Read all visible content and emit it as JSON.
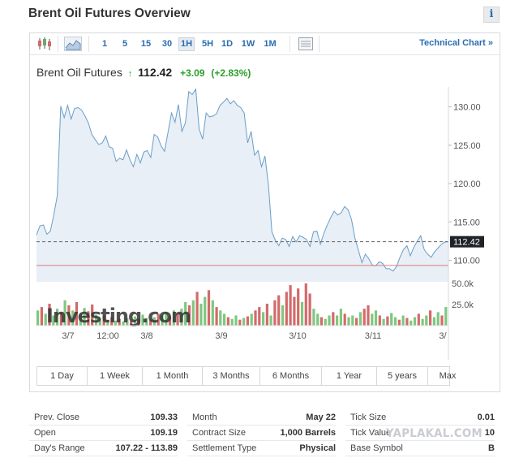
{
  "page": {
    "title": "Brent Oil Futures Overview",
    "info_icon": "i"
  },
  "toolbar": {
    "timeframes": [
      "1",
      "5",
      "15",
      "30",
      "1H",
      "5H",
      "1D",
      "1W",
      "1M"
    ],
    "active_timeframe": "1H",
    "technical_chart_label": "Technical Chart »"
  },
  "quote": {
    "name": "Brent Oil Futures",
    "arrow": "↑",
    "price": "112.42",
    "change": "+3.09",
    "change_pct": "(+2.83%)",
    "up_color": "#2ba02b"
  },
  "chart_data": {
    "type": "area",
    "title": "",
    "xlabel": "",
    "ylabel": "",
    "x_tick_labels": [
      "3/7",
      "12:00",
      "3/8",
      "3/9",
      "3/10",
      "3/11",
      "3/"
    ],
    "y_tick_labels": [
      "130.00",
      "125.00",
      "120.00",
      "115.00",
      "110.00"
    ],
    "ylim": [
      107.2,
      132.6
    ],
    "last_price": 112.42,
    "last_price_label": "112.42",
    "prev_close": 109.33,
    "grid": false,
    "series": [
      {
        "values": [
          113.3,
          114.5,
          114.6,
          113.4,
          113.8,
          115.9,
          118.4,
          130.1,
          128.6,
          130.2,
          128.4,
          129.8,
          129.9,
          129.6,
          128.8,
          127.9,
          126.4,
          125.7,
          125.1,
          125.3,
          126.2,
          124.8,
          124.6,
          122.9,
          123.3,
          123.1,
          124.4,
          123.1,
          122.2,
          123.8,
          122.7,
          124.1,
          124.3,
          123.4,
          126.4,
          126.1,
          124.9,
          124.2,
          126.7,
          129.2,
          128.0,
          130.3,
          126.8,
          127.9,
          132.0,
          131.6,
          132.3,
          127.1,
          125.8,
          129.2,
          128.7,
          128.8,
          129.1,
          130.2,
          130.6,
          131.1,
          130.4,
          130.8,
          130.2,
          129.9,
          129.2,
          125.3,
          126.8,
          123.7,
          124.3,
          122.2,
          123.6,
          119.8,
          113.7,
          112.6,
          111.9,
          112.9,
          112.7,
          111.8,
          113.1,
          112.4,
          113.2,
          113.0,
          112.7,
          111.8,
          113.7,
          113.8,
          112.1,
          113.5,
          114.6,
          115.6,
          116.4,
          115.9,
          116.2,
          117.0,
          116.6,
          115.3,
          112.9,
          111.3,
          109.7,
          110.8,
          110.2,
          109.4,
          109.3,
          109.8,
          109.6,
          108.9,
          108.9,
          108.6,
          109.2,
          110.4,
          111.4,
          111.9,
          110.6,
          111.7,
          112.5,
          113.2,
          111.4,
          110.8,
          110.4,
          111.1,
          111.6,
          112.1,
          112.4,
          112.42
        ],
        "color": "#6a9ec8",
        "fill": "#e8eff6"
      }
    ],
    "volume": {
      "tick_labels": [
        "50.0k",
        "25.0k"
      ],
      "bars": [
        {
          "v": 18,
          "c": "g"
        },
        {
          "v": 22,
          "c": "r"
        },
        {
          "v": 14,
          "c": "g"
        },
        {
          "v": 26,
          "c": "r"
        },
        {
          "v": 12,
          "c": "g"
        },
        {
          "v": 20,
          "c": "g"
        },
        {
          "v": 16,
          "c": "r"
        },
        {
          "v": 30,
          "c": "g"
        },
        {
          "v": 24,
          "c": "r"
        },
        {
          "v": 18,
          "c": "g"
        },
        {
          "v": 28,
          "c": "r"
        },
        {
          "v": 14,
          "c": "g"
        },
        {
          "v": 21,
          "c": "g"
        },
        {
          "v": 17,
          "c": "r"
        },
        {
          "v": 25,
          "c": "r"
        },
        {
          "v": 13,
          "c": "g"
        },
        {
          "v": 9,
          "c": "g"
        },
        {
          "v": 12,
          "c": "r"
        },
        {
          "v": 7,
          "c": "g"
        },
        {
          "v": 10,
          "c": "r"
        },
        {
          "v": 6,
          "c": "g"
        },
        {
          "v": 8,
          "c": "r"
        },
        {
          "v": 5,
          "c": "g"
        },
        {
          "v": 9,
          "c": "g"
        },
        {
          "v": 6,
          "c": "r"
        },
        {
          "v": 11,
          "c": "g"
        },
        {
          "v": 8,
          "c": "r"
        },
        {
          "v": 13,
          "c": "g"
        },
        {
          "v": 9,
          "c": "g"
        },
        {
          "v": 7,
          "c": "r"
        },
        {
          "v": 10,
          "c": "g"
        },
        {
          "v": 14,
          "c": "r"
        },
        {
          "v": 12,
          "c": "g"
        },
        {
          "v": 16,
          "c": "g"
        },
        {
          "v": 11,
          "c": "r"
        },
        {
          "v": 18,
          "c": "g"
        },
        {
          "v": 15,
          "c": "r"
        },
        {
          "v": 20,
          "c": "g"
        },
        {
          "v": 28,
          "c": "g"
        },
        {
          "v": 24,
          "c": "r"
        },
        {
          "v": 30,
          "c": "g"
        },
        {
          "v": 40,
          "c": "r"
        },
        {
          "v": 26,
          "c": "g"
        },
        {
          "v": 34,
          "c": "g"
        },
        {
          "v": 42,
          "c": "r"
        },
        {
          "v": 30,
          "c": "g"
        },
        {
          "v": 22,
          "c": "r"
        },
        {
          "v": 18,
          "c": "g"
        },
        {
          "v": 14,
          "c": "g"
        },
        {
          "v": 10,
          "c": "r"
        },
        {
          "v": 8,
          "c": "g"
        },
        {
          "v": 12,
          "c": "g"
        },
        {
          "v": 7,
          "c": "r"
        },
        {
          "v": 9,
          "c": "g"
        },
        {
          "v": 11,
          "c": "r"
        },
        {
          "v": 14,
          "c": "g"
        },
        {
          "v": 18,
          "c": "r"
        },
        {
          "v": 22,
          "c": "r"
        },
        {
          "v": 16,
          "c": "g"
        },
        {
          "v": 26,
          "c": "r"
        },
        {
          "v": 12,
          "c": "g"
        },
        {
          "v": 30,
          "c": "r"
        },
        {
          "v": 36,
          "c": "r"
        },
        {
          "v": 24,
          "c": "g"
        },
        {
          "v": 40,
          "c": "r"
        },
        {
          "v": 48,
          "c": "r"
        },
        {
          "v": 34,
          "c": "r"
        },
        {
          "v": 44,
          "c": "r"
        },
        {
          "v": 28,
          "c": "g"
        },
        {
          "v": 50,
          "c": "r"
        },
        {
          "v": 38,
          "c": "r"
        },
        {
          "v": 20,
          "c": "g"
        },
        {
          "v": 14,
          "c": "g"
        },
        {
          "v": 10,
          "c": "r"
        },
        {
          "v": 8,
          "c": "g"
        },
        {
          "v": 12,
          "c": "g"
        },
        {
          "v": 16,
          "c": "r"
        },
        {
          "v": 12,
          "c": "g"
        },
        {
          "v": 20,
          "c": "g"
        },
        {
          "v": 14,
          "c": "r"
        },
        {
          "v": 10,
          "c": "g"
        },
        {
          "v": 12,
          "c": "g"
        },
        {
          "v": 9,
          "c": "r"
        },
        {
          "v": 16,
          "c": "g"
        },
        {
          "v": 20,
          "c": "r"
        },
        {
          "v": 24,
          "c": "r"
        },
        {
          "v": 14,
          "c": "g"
        },
        {
          "v": 18,
          "c": "g"
        },
        {
          "v": 12,
          "c": "r"
        },
        {
          "v": 8,
          "c": "g"
        },
        {
          "v": 11,
          "c": "r"
        },
        {
          "v": 15,
          "c": "g"
        },
        {
          "v": 10,
          "c": "g"
        },
        {
          "v": 7,
          "c": "r"
        },
        {
          "v": 12,
          "c": "g"
        },
        {
          "v": 9,
          "c": "r"
        },
        {
          "v": 6,
          "c": "g"
        },
        {
          "v": 10,
          "c": "g"
        },
        {
          "v": 14,
          "c": "r"
        },
        {
          "v": 8,
          "c": "g"
        },
        {
          "v": 12,
          "c": "g"
        },
        {
          "v": 18,
          "c": "r"
        },
        {
          "v": 10,
          "c": "g"
        },
        {
          "v": 16,
          "c": "g"
        },
        {
          "v": 12,
          "c": "r"
        },
        {
          "v": 22,
          "c": "g"
        }
      ],
      "up_color": "#7fc77f",
      "down_color": "#d36a6a"
    },
    "watermark": "Investing.com"
  },
  "ranges": [
    "1 Day",
    "1 Week",
    "1 Month",
    "3 Months",
    "6 Months",
    "1 Year",
    "5 years",
    "Max"
  ],
  "stats": [
    [
      {
        "label": "Prev. Close",
        "value": "109.33"
      },
      {
        "label": "Month",
        "value": "May 22"
      },
      {
        "label": "Tick Size",
        "value": "0.01"
      }
    ],
    [
      {
        "label": "Open",
        "value": "109.19"
      },
      {
        "label": "Contract Size",
        "value": "1,000 Barrels"
      },
      {
        "label": "Tick Value",
        "value": "10"
      }
    ],
    [
      {
        "label": "Day's Range",
        "value": "107.22 - 113.89"
      },
      {
        "label": "Settlement Type",
        "value": "Physical"
      },
      {
        "label": "Base Symbol",
        "value": "B"
      }
    ]
  ],
  "watermark_site": "YAPLAKAL.COM"
}
